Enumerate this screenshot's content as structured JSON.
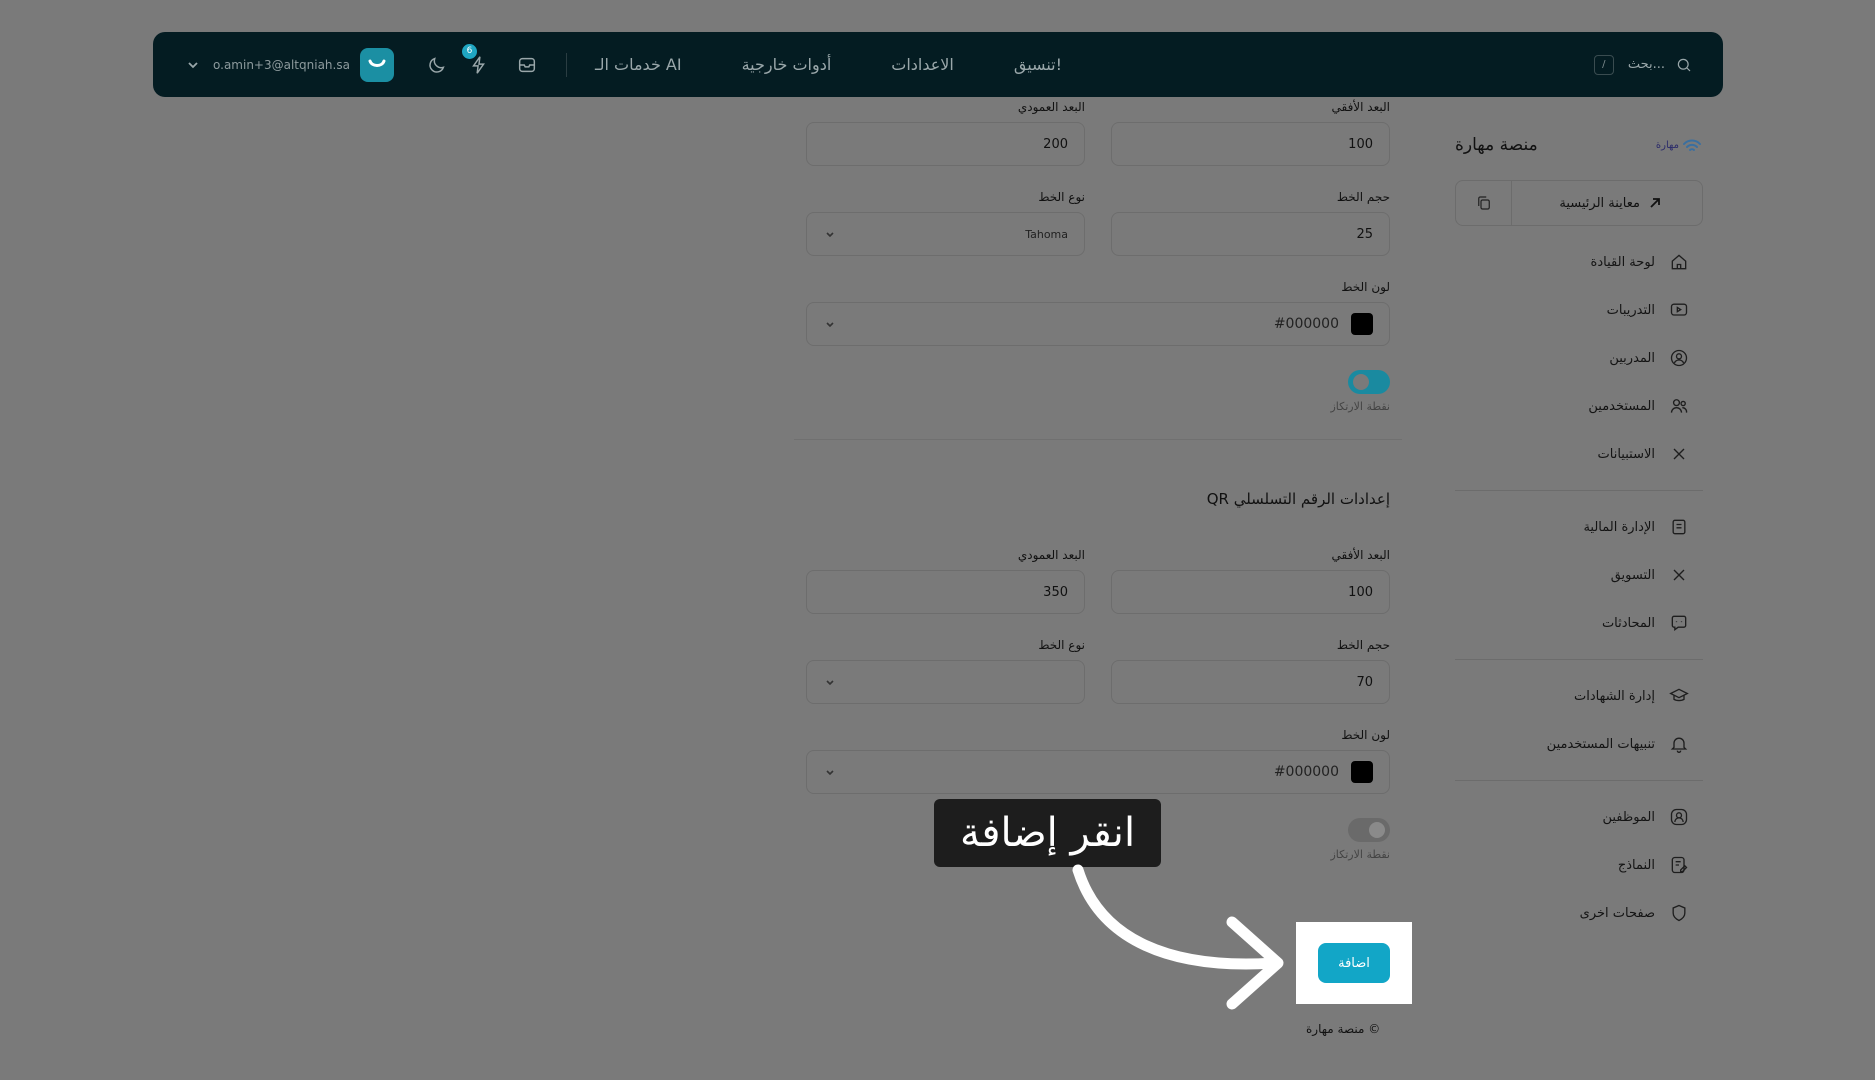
{
  "topbar": {
    "email": "o.amin+3@altqniah.sa",
    "badge_count": "6",
    "nav": [
      {
        "label": "خدمات الـ AI",
        "icon": "sparkles-icon"
      },
      {
        "label": "أدوات خارجية",
        "icon": "grid-icon"
      },
      {
        "label": "الاعدادات",
        "icon": "gear-icon"
      },
      {
        "label": "تنسيق!",
        "icon": "layout-icon"
      }
    ],
    "search_placeholder": "بحث...",
    "shortcut": "/"
  },
  "sidebar": {
    "brand": "منصة مهارة",
    "logo_text": "مهارة",
    "preview_label": "معاينة الرئيسية",
    "items": [
      {
        "label": "لوحة القيادة"
      },
      {
        "label": "التدريبات"
      },
      {
        "label": "المدربين"
      },
      {
        "label": "المستخدمين"
      },
      {
        "label": "الاستبيانات"
      },
      {
        "label": "الإدارة المالية"
      },
      {
        "label": "التسويق"
      },
      {
        "label": "المحادثات"
      },
      {
        "label": "إدارة الشهادات"
      },
      {
        "label": "تنبيهات المستخدمين"
      },
      {
        "label": "الموظفين"
      },
      {
        "label": "النماذج"
      },
      {
        "label": "صفحات اخرى"
      }
    ]
  },
  "form": {
    "s1": {
      "h_label": "البعد الأفقي",
      "h_value": "100",
      "v_label": "البعد العمودي",
      "v_value": "200",
      "size_label": "حجم الخط",
      "size_value": "25",
      "font_label": "نوع الخط",
      "font_value": "Tahoma",
      "color_label": "لون الخط",
      "color_value": "#000000",
      "anchor_label": "نقطة الارتكاز"
    },
    "s2": {
      "title": "إعدادات الرقم التسلسلي QR",
      "h_label": "البعد الأفقي",
      "h_value": "100",
      "v_label": "البعد العمودي",
      "v_value": "350",
      "size_label": "حجم الخط",
      "size_value": "70",
      "font_label": "نوع الخط",
      "font_value": "",
      "color_label": "لون الخط",
      "color_value": "#000000",
      "anchor_label": "نقطة الارتكاز"
    },
    "add_label": "اضافة"
  },
  "footer": "© منصة مهارة",
  "tooltip": "انقر إضافة"
}
